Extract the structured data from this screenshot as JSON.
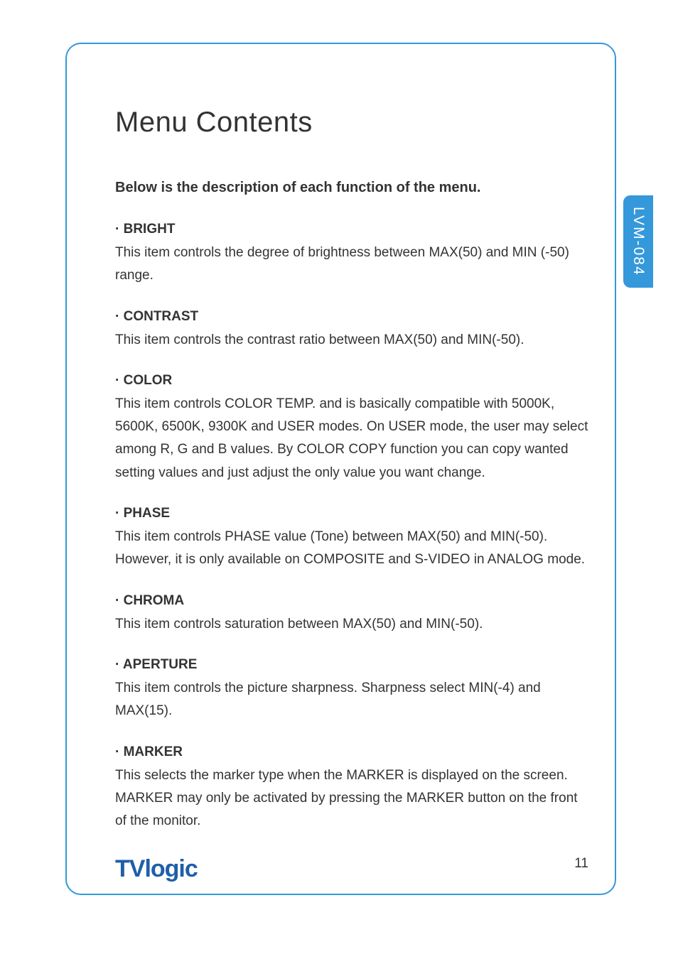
{
  "sideTab": "LVM-084",
  "title": "Menu Contents",
  "intro": "Below is the description of each function of the menu.",
  "sections": [
    {
      "heading": "· BRIGHT",
      "body": "This item controls the degree of brightness between MAX(50) and MIN (-50) range."
    },
    {
      "heading": "· CONTRAST",
      "body": "This item controls the contrast ratio between MAX(50) and MIN(-50)."
    },
    {
      "heading": "· COLOR",
      "body": "This item controls COLOR TEMP. and is basically compatible with 5000K, 5600K, 6500K, 9300K and USER modes. On USER mode, the user may select among R, G and B values. By COLOR COPY function you can copy wanted setting values and just adjust the only value you want change."
    },
    {
      "heading": "· PHASE",
      "body": "This item controls PHASE value (Tone) between MAX(50) and MIN(-50). However, it is only available on COMPOSITE and S-VIDEO in ANALOG mode."
    },
    {
      "heading": "· CHROMA",
      "body": "This item controls saturation between MAX(50) and MIN(-50)."
    },
    {
      "heading": "· APERTURE",
      "body": "This item controls the picture sharpness. Sharpness select MIN(-4) and MAX(15)."
    },
    {
      "heading": "· MARKER",
      "body": "This selects the marker type when the MARKER is displayed on the screen. MARKER may only be activated by pressing the MARKER button on the front of the monitor."
    }
  ],
  "logo": "TVlogic",
  "pageNumber": "11"
}
